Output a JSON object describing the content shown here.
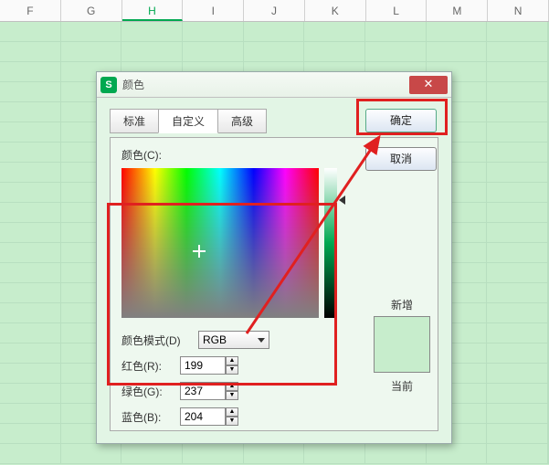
{
  "columns": [
    "F",
    "G",
    "H",
    "I",
    "J",
    "K",
    "L",
    "M",
    "N"
  ],
  "active_column": "H",
  "dialog": {
    "title": "颜色",
    "tabs": {
      "standard": "标准",
      "custom": "自定义",
      "advanced": "高级",
      "active": "custom"
    },
    "color_label": "颜色(C):",
    "mode_label": "颜色模式(D)",
    "mode_value": "RGB",
    "r_label": "红色(R):",
    "g_label": "绿色(G):",
    "b_label": "蓝色(B):",
    "r": "199",
    "g": "237",
    "b": "204",
    "ok": "确定",
    "cancel": "取消",
    "new": "新增",
    "current": "当前",
    "preview_color": "#c7edcc"
  }
}
